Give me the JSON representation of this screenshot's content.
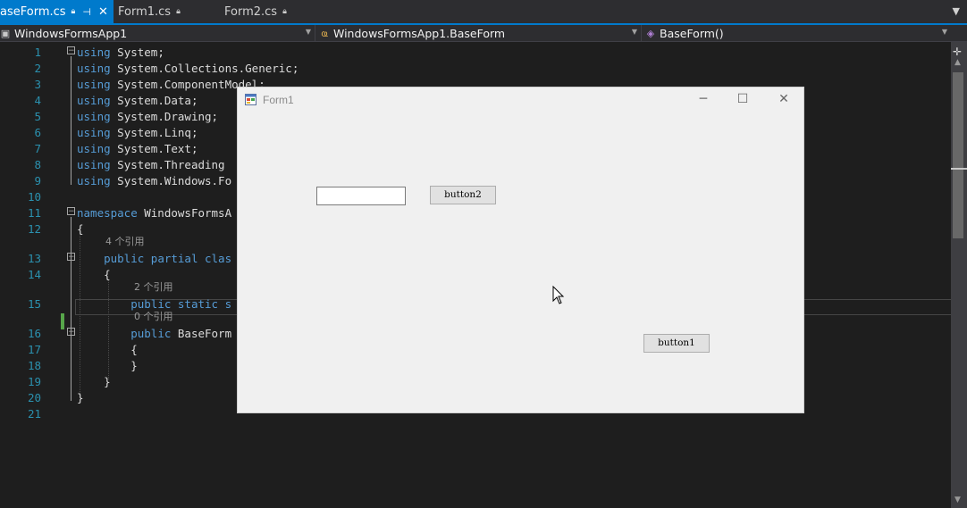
{
  "tabs": [
    {
      "label": "aseForm.cs",
      "active": true
    },
    {
      "label": "Form1.cs",
      "active": false
    },
    {
      "label": "Form2.cs",
      "active": false
    }
  ],
  "navbar": {
    "project": "WindowsFormsApp1",
    "type": "WindowsFormsApp1.BaseForm",
    "member": "BaseForm()"
  },
  "lines": [
    {
      "n": "1",
      "code": [
        [
          "kw",
          "using"
        ],
        [
          "txt",
          " System;"
        ]
      ]
    },
    {
      "n": "2",
      "code": [
        [
          "kw",
          "using"
        ],
        [
          "txt",
          " System.Collections.Generic;"
        ]
      ]
    },
    {
      "n": "3",
      "code": [
        [
          "kw",
          "using"
        ],
        [
          "txt",
          " System.ComponentModel;"
        ]
      ]
    },
    {
      "n": "4",
      "code": [
        [
          "kw",
          "using"
        ],
        [
          "txt",
          " System.Data;"
        ]
      ]
    },
    {
      "n": "5",
      "code": [
        [
          "kw",
          "using"
        ],
        [
          "txt",
          " System.Drawing;"
        ]
      ]
    },
    {
      "n": "6",
      "code": [
        [
          "kw",
          "using"
        ],
        [
          "txt",
          " System.Linq;"
        ]
      ]
    },
    {
      "n": "7",
      "code": [
        [
          "kw",
          "using"
        ],
        [
          "txt",
          " System.Text;"
        ]
      ]
    },
    {
      "n": "8",
      "code": [
        [
          "kw",
          "using"
        ],
        [
          "txt",
          " System.Threading"
        ]
      ]
    },
    {
      "n": "9",
      "code": [
        [
          "kw",
          "using"
        ],
        [
          "txt",
          " System.Windows.Fo"
        ]
      ]
    },
    {
      "n": "10",
      "code": []
    },
    {
      "n": "11",
      "code": [
        [
          "kw",
          "namespace"
        ],
        [
          "txt",
          " WindowsFormsA"
        ]
      ]
    },
    {
      "n": "12",
      "code": [
        [
          "txt",
          "{"
        ]
      ]
    },
    {
      "n": "13",
      "code": [
        [
          "txt",
          "    "
        ],
        [
          "kw",
          "public partial clas"
        ]
      ]
    },
    {
      "n": "14",
      "code": [
        [
          "txt",
          "    {"
        ]
      ]
    },
    {
      "n": "15",
      "code": [
        [
          "txt",
          "        "
        ],
        [
          "kw",
          "public static s"
        ]
      ]
    },
    {
      "n": "16",
      "code": [
        [
          "txt",
          "        "
        ],
        [
          "kw",
          "public"
        ],
        [
          "txt",
          " BaseForm"
        ]
      ]
    },
    {
      "n": "17",
      "code": [
        [
          "txt",
          "        {"
        ]
      ]
    },
    {
      "n": "18",
      "code": [
        [
          "txt",
          "        }"
        ]
      ]
    },
    {
      "n": "19",
      "code": [
        [
          "txt",
          "    }"
        ]
      ]
    },
    {
      "n": "20",
      "code": [
        [
          "txt",
          "}"
        ]
      ]
    },
    {
      "n": "21",
      "code": []
    }
  ],
  "codelens": {
    "class_refs": "4 个引用",
    "method1_refs": "2 个引用",
    "ctor_refs": "0 个引用"
  },
  "form1": {
    "title": "Form1",
    "minimize": "─",
    "maximize": "☐",
    "close": "✕",
    "button1": "button1",
    "button2": "button2",
    "textbox_value": ""
  }
}
